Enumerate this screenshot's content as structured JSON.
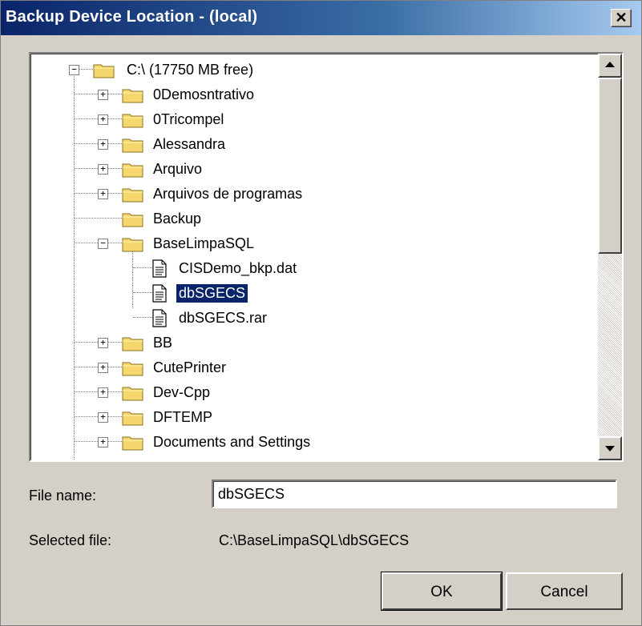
{
  "window": {
    "title": "Backup Device Location - (local)",
    "close_glyph": "✕"
  },
  "tree": {
    "items": [
      {
        "label": "C:\\ (17750 MB free)",
        "kind": "folder",
        "level": 0,
        "expander": "−"
      },
      {
        "label": "0Demosntrativo",
        "kind": "folder",
        "level": 1,
        "expander": "+"
      },
      {
        "label": "0Tricompel",
        "kind": "folder",
        "level": 1,
        "expander": "+"
      },
      {
        "label": "Alessandra",
        "kind": "folder",
        "level": 1,
        "expander": "+"
      },
      {
        "label": "Arquivo",
        "kind": "folder",
        "level": 1,
        "expander": "+"
      },
      {
        "label": "Arquivos de programas",
        "kind": "folder",
        "level": 1,
        "expander": "+"
      },
      {
        "label": "Backup",
        "kind": "folder",
        "level": 1,
        "expander": ""
      },
      {
        "label": "BaseLimpaSQL",
        "kind": "folder",
        "level": 1,
        "expander": "−"
      },
      {
        "label": "CISDemo_bkp.dat",
        "kind": "file",
        "level": 2,
        "expander": ""
      },
      {
        "label": "dbSGECS",
        "kind": "file",
        "level": 2,
        "expander": "",
        "selected": true
      },
      {
        "label": "dbSGECS.rar",
        "kind": "file",
        "level": 2,
        "expander": ""
      },
      {
        "label": "BB",
        "kind": "folder",
        "level": 1,
        "expander": "+"
      },
      {
        "label": "CutePrinter",
        "kind": "folder",
        "level": 1,
        "expander": "+"
      },
      {
        "label": "Dev-Cpp",
        "kind": "folder",
        "level": 1,
        "expander": "+"
      },
      {
        "label": "DFTEMP",
        "kind": "folder",
        "level": 1,
        "expander": "+"
      },
      {
        "label": "Documents and Settings",
        "kind": "folder",
        "level": 1,
        "expander": "+"
      }
    ]
  },
  "file_name": {
    "label": "File name:",
    "value": "dbSGECS"
  },
  "selected_file": {
    "label": "Selected file:",
    "value": "C:\\BaseLimpaSQL\\dbSGECS"
  },
  "buttons": {
    "ok": "OK",
    "cancel": "Cancel"
  },
  "colors": {
    "title_start": "#0a246a",
    "selection": "#0a246a",
    "face": "#d4d0c8",
    "folder": "#f5d76e"
  },
  "icons": {
    "folder": "folder-icon",
    "file": "document-icon",
    "scroll_up": "scroll-up-arrow-icon",
    "scroll_down": "scroll-down-arrow-icon"
  }
}
